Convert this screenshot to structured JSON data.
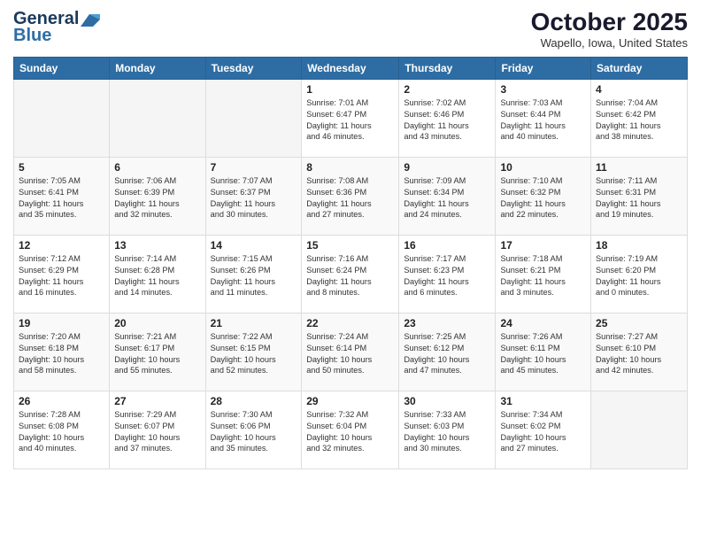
{
  "header": {
    "logo_line1": "General",
    "logo_line2": "Blue",
    "month": "October 2025",
    "location": "Wapello, Iowa, United States"
  },
  "weekdays": [
    "Sunday",
    "Monday",
    "Tuesday",
    "Wednesday",
    "Thursday",
    "Friday",
    "Saturday"
  ],
  "weeks": [
    [
      {
        "day": "",
        "info": ""
      },
      {
        "day": "",
        "info": ""
      },
      {
        "day": "",
        "info": ""
      },
      {
        "day": "1",
        "info": "Sunrise: 7:01 AM\nSunset: 6:47 PM\nDaylight: 11 hours\nand 46 minutes."
      },
      {
        "day": "2",
        "info": "Sunrise: 7:02 AM\nSunset: 6:46 PM\nDaylight: 11 hours\nand 43 minutes."
      },
      {
        "day": "3",
        "info": "Sunrise: 7:03 AM\nSunset: 6:44 PM\nDaylight: 11 hours\nand 40 minutes."
      },
      {
        "day": "4",
        "info": "Sunrise: 7:04 AM\nSunset: 6:42 PM\nDaylight: 11 hours\nand 38 minutes."
      }
    ],
    [
      {
        "day": "5",
        "info": "Sunrise: 7:05 AM\nSunset: 6:41 PM\nDaylight: 11 hours\nand 35 minutes."
      },
      {
        "day": "6",
        "info": "Sunrise: 7:06 AM\nSunset: 6:39 PM\nDaylight: 11 hours\nand 32 minutes."
      },
      {
        "day": "7",
        "info": "Sunrise: 7:07 AM\nSunset: 6:37 PM\nDaylight: 11 hours\nand 30 minutes."
      },
      {
        "day": "8",
        "info": "Sunrise: 7:08 AM\nSunset: 6:36 PM\nDaylight: 11 hours\nand 27 minutes."
      },
      {
        "day": "9",
        "info": "Sunrise: 7:09 AM\nSunset: 6:34 PM\nDaylight: 11 hours\nand 24 minutes."
      },
      {
        "day": "10",
        "info": "Sunrise: 7:10 AM\nSunset: 6:32 PM\nDaylight: 11 hours\nand 22 minutes."
      },
      {
        "day": "11",
        "info": "Sunrise: 7:11 AM\nSunset: 6:31 PM\nDaylight: 11 hours\nand 19 minutes."
      }
    ],
    [
      {
        "day": "12",
        "info": "Sunrise: 7:12 AM\nSunset: 6:29 PM\nDaylight: 11 hours\nand 16 minutes."
      },
      {
        "day": "13",
        "info": "Sunrise: 7:14 AM\nSunset: 6:28 PM\nDaylight: 11 hours\nand 14 minutes."
      },
      {
        "day": "14",
        "info": "Sunrise: 7:15 AM\nSunset: 6:26 PM\nDaylight: 11 hours\nand 11 minutes."
      },
      {
        "day": "15",
        "info": "Sunrise: 7:16 AM\nSunset: 6:24 PM\nDaylight: 11 hours\nand 8 minutes."
      },
      {
        "day": "16",
        "info": "Sunrise: 7:17 AM\nSunset: 6:23 PM\nDaylight: 11 hours\nand 6 minutes."
      },
      {
        "day": "17",
        "info": "Sunrise: 7:18 AM\nSunset: 6:21 PM\nDaylight: 11 hours\nand 3 minutes."
      },
      {
        "day": "18",
        "info": "Sunrise: 7:19 AM\nSunset: 6:20 PM\nDaylight: 11 hours\nand 0 minutes."
      }
    ],
    [
      {
        "day": "19",
        "info": "Sunrise: 7:20 AM\nSunset: 6:18 PM\nDaylight: 10 hours\nand 58 minutes."
      },
      {
        "day": "20",
        "info": "Sunrise: 7:21 AM\nSunset: 6:17 PM\nDaylight: 10 hours\nand 55 minutes."
      },
      {
        "day": "21",
        "info": "Sunrise: 7:22 AM\nSunset: 6:15 PM\nDaylight: 10 hours\nand 52 minutes."
      },
      {
        "day": "22",
        "info": "Sunrise: 7:24 AM\nSunset: 6:14 PM\nDaylight: 10 hours\nand 50 minutes."
      },
      {
        "day": "23",
        "info": "Sunrise: 7:25 AM\nSunset: 6:12 PM\nDaylight: 10 hours\nand 47 minutes."
      },
      {
        "day": "24",
        "info": "Sunrise: 7:26 AM\nSunset: 6:11 PM\nDaylight: 10 hours\nand 45 minutes."
      },
      {
        "day": "25",
        "info": "Sunrise: 7:27 AM\nSunset: 6:10 PM\nDaylight: 10 hours\nand 42 minutes."
      }
    ],
    [
      {
        "day": "26",
        "info": "Sunrise: 7:28 AM\nSunset: 6:08 PM\nDaylight: 10 hours\nand 40 minutes."
      },
      {
        "day": "27",
        "info": "Sunrise: 7:29 AM\nSunset: 6:07 PM\nDaylight: 10 hours\nand 37 minutes."
      },
      {
        "day": "28",
        "info": "Sunrise: 7:30 AM\nSunset: 6:06 PM\nDaylight: 10 hours\nand 35 minutes."
      },
      {
        "day": "29",
        "info": "Sunrise: 7:32 AM\nSunset: 6:04 PM\nDaylight: 10 hours\nand 32 minutes."
      },
      {
        "day": "30",
        "info": "Sunrise: 7:33 AM\nSunset: 6:03 PM\nDaylight: 10 hours\nand 30 minutes."
      },
      {
        "day": "31",
        "info": "Sunrise: 7:34 AM\nSunset: 6:02 PM\nDaylight: 10 hours\nand 27 minutes."
      },
      {
        "day": "",
        "info": ""
      }
    ]
  ]
}
